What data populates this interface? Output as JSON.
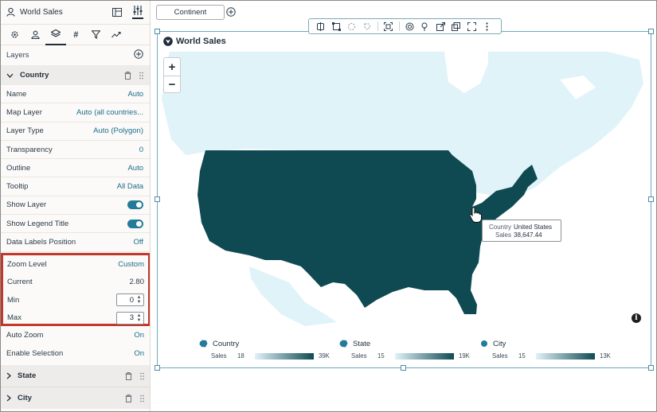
{
  "panel": {
    "title": "World Sales",
    "layers_label": "Layers",
    "sections": [
      {
        "name": "Country",
        "expanded": true
      },
      {
        "name": "State",
        "expanded": false
      },
      {
        "name": "City",
        "expanded": false
      }
    ],
    "properties": [
      {
        "key": "Name",
        "value": "Auto"
      },
      {
        "key": "Map Layer",
        "value": "Auto (all countries..."
      },
      {
        "key": "Layer Type",
        "value": "Auto (Polygon)"
      },
      {
        "key": "Transparency",
        "value": "0"
      },
      {
        "key": "Outline",
        "value": "Auto"
      },
      {
        "key": "Tooltip",
        "value": "All Data"
      },
      {
        "key": "Show Layer",
        "value": ""
      },
      {
        "key": "Show Legend Title",
        "value": ""
      },
      {
        "key": "Data Labels Position",
        "value": "Off"
      }
    ],
    "zoom": {
      "level_label": "Zoom Level",
      "level_value": "Custom",
      "current_label": "Current",
      "current_value": "2.80",
      "min_label": "Min",
      "min_value": "0",
      "max_label": "Max",
      "max_value": "3"
    },
    "after": [
      {
        "key": "Auto Zoom",
        "value": "On"
      },
      {
        "key": "Enable Selection",
        "value": "On"
      }
    ]
  },
  "toolbar": {
    "filter_pill": "Continent"
  },
  "viz": {
    "title": "World Sales",
    "tooltip": {
      "k1": "Country",
      "v1": "United States",
      "k2": "Sales",
      "v2": "38,647.44"
    },
    "legend": [
      {
        "name": "Country",
        "measure": "Sales",
        "min": "18",
        "max": "39K"
      },
      {
        "name": "State",
        "measure": "Sales",
        "min": "15",
        "max": "19K"
      },
      {
        "name": "City",
        "measure": "Sales",
        "min": "15",
        "max": "13K"
      }
    ]
  },
  "colors": {
    "accent": "#237b99",
    "map_fill": "#0f4a52",
    "land": "#e0f3f8",
    "highlight": "#c0392b"
  }
}
